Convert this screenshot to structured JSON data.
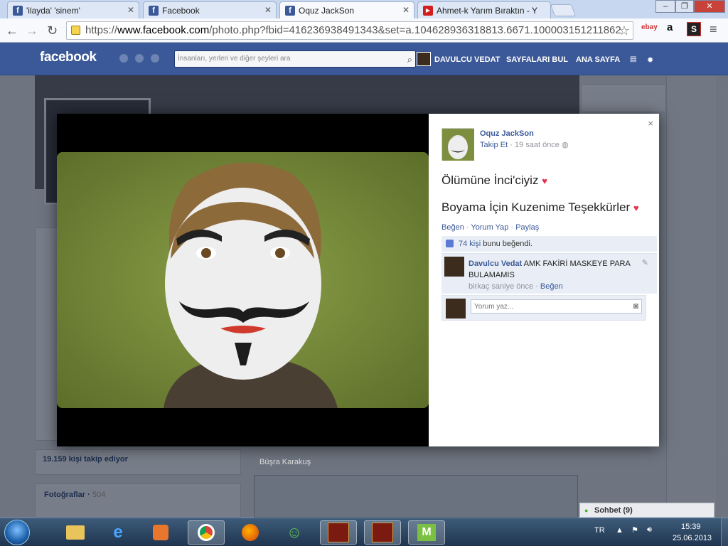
{
  "browser": {
    "tabs": [
      {
        "label": "'ilayda' 'sinem'",
        "icon": "facebook-icon",
        "active": false
      },
      {
        "label": "Facebook",
        "icon": "facebook-icon",
        "active": false
      },
      {
        "label": "Oquz JackSon",
        "icon": "facebook-icon",
        "active": true
      },
      {
        "label": "Ahmet-k Yarım Bıraktın - Y",
        "icon": "youtube-icon",
        "active": false
      }
    ],
    "url_scheme": "https://",
    "url_host": "www.facebook.com",
    "url_path": "/photo.php?fbid=416236938491343&set=a.104628936318813.6671.100003151211862",
    "extensions": [
      "ebay",
      "a",
      "S"
    ]
  },
  "facebook": {
    "logo": "facebook",
    "search_placeholder": "İnsanları, yerleri ve diğer şeyleri ara",
    "nav": [
      "DAVULCU VEDAT",
      "SAYFALARI BUL",
      "ANA SAYFA"
    ],
    "background": {
      "followers": "19.159 kişi takip ediyor",
      "photos_label": "Fotoğraflar",
      "photos_count": "504",
      "feed_name": "Büşra Karakuş",
      "chat_label": "Sohbet",
      "chat_count": "(9)"
    }
  },
  "photo_viewer": {
    "author": "Oquz JackSon",
    "follow": "Takip Et",
    "time": "19 saat önce",
    "close": "×",
    "caption_lines": [
      "Ölümüne İnci'ciyiz",
      "Boyama İçin Kuzenime Teşekkürler"
    ],
    "actions": [
      "Beğen",
      "Yorum Yap",
      "Paylaş"
    ],
    "likes_count": "74 kişi",
    "likes_suffix": "bunu beğendi.",
    "comment": {
      "author": "Davulcu Vedat",
      "text": "AMK FAKİRİ MASKEYE PARA BULAMAMIS",
      "time": "birkaç saniye önce",
      "like": "Beğen"
    },
    "comment_placeholder": "Yorum yaz..."
  },
  "taskbar": {
    "language": "TR",
    "time": "15:39",
    "date": "25.06.2013"
  },
  "colors": {
    "facebook_blue": "#3b5998",
    "link": "#3b5998",
    "heart": "#e3334a"
  }
}
